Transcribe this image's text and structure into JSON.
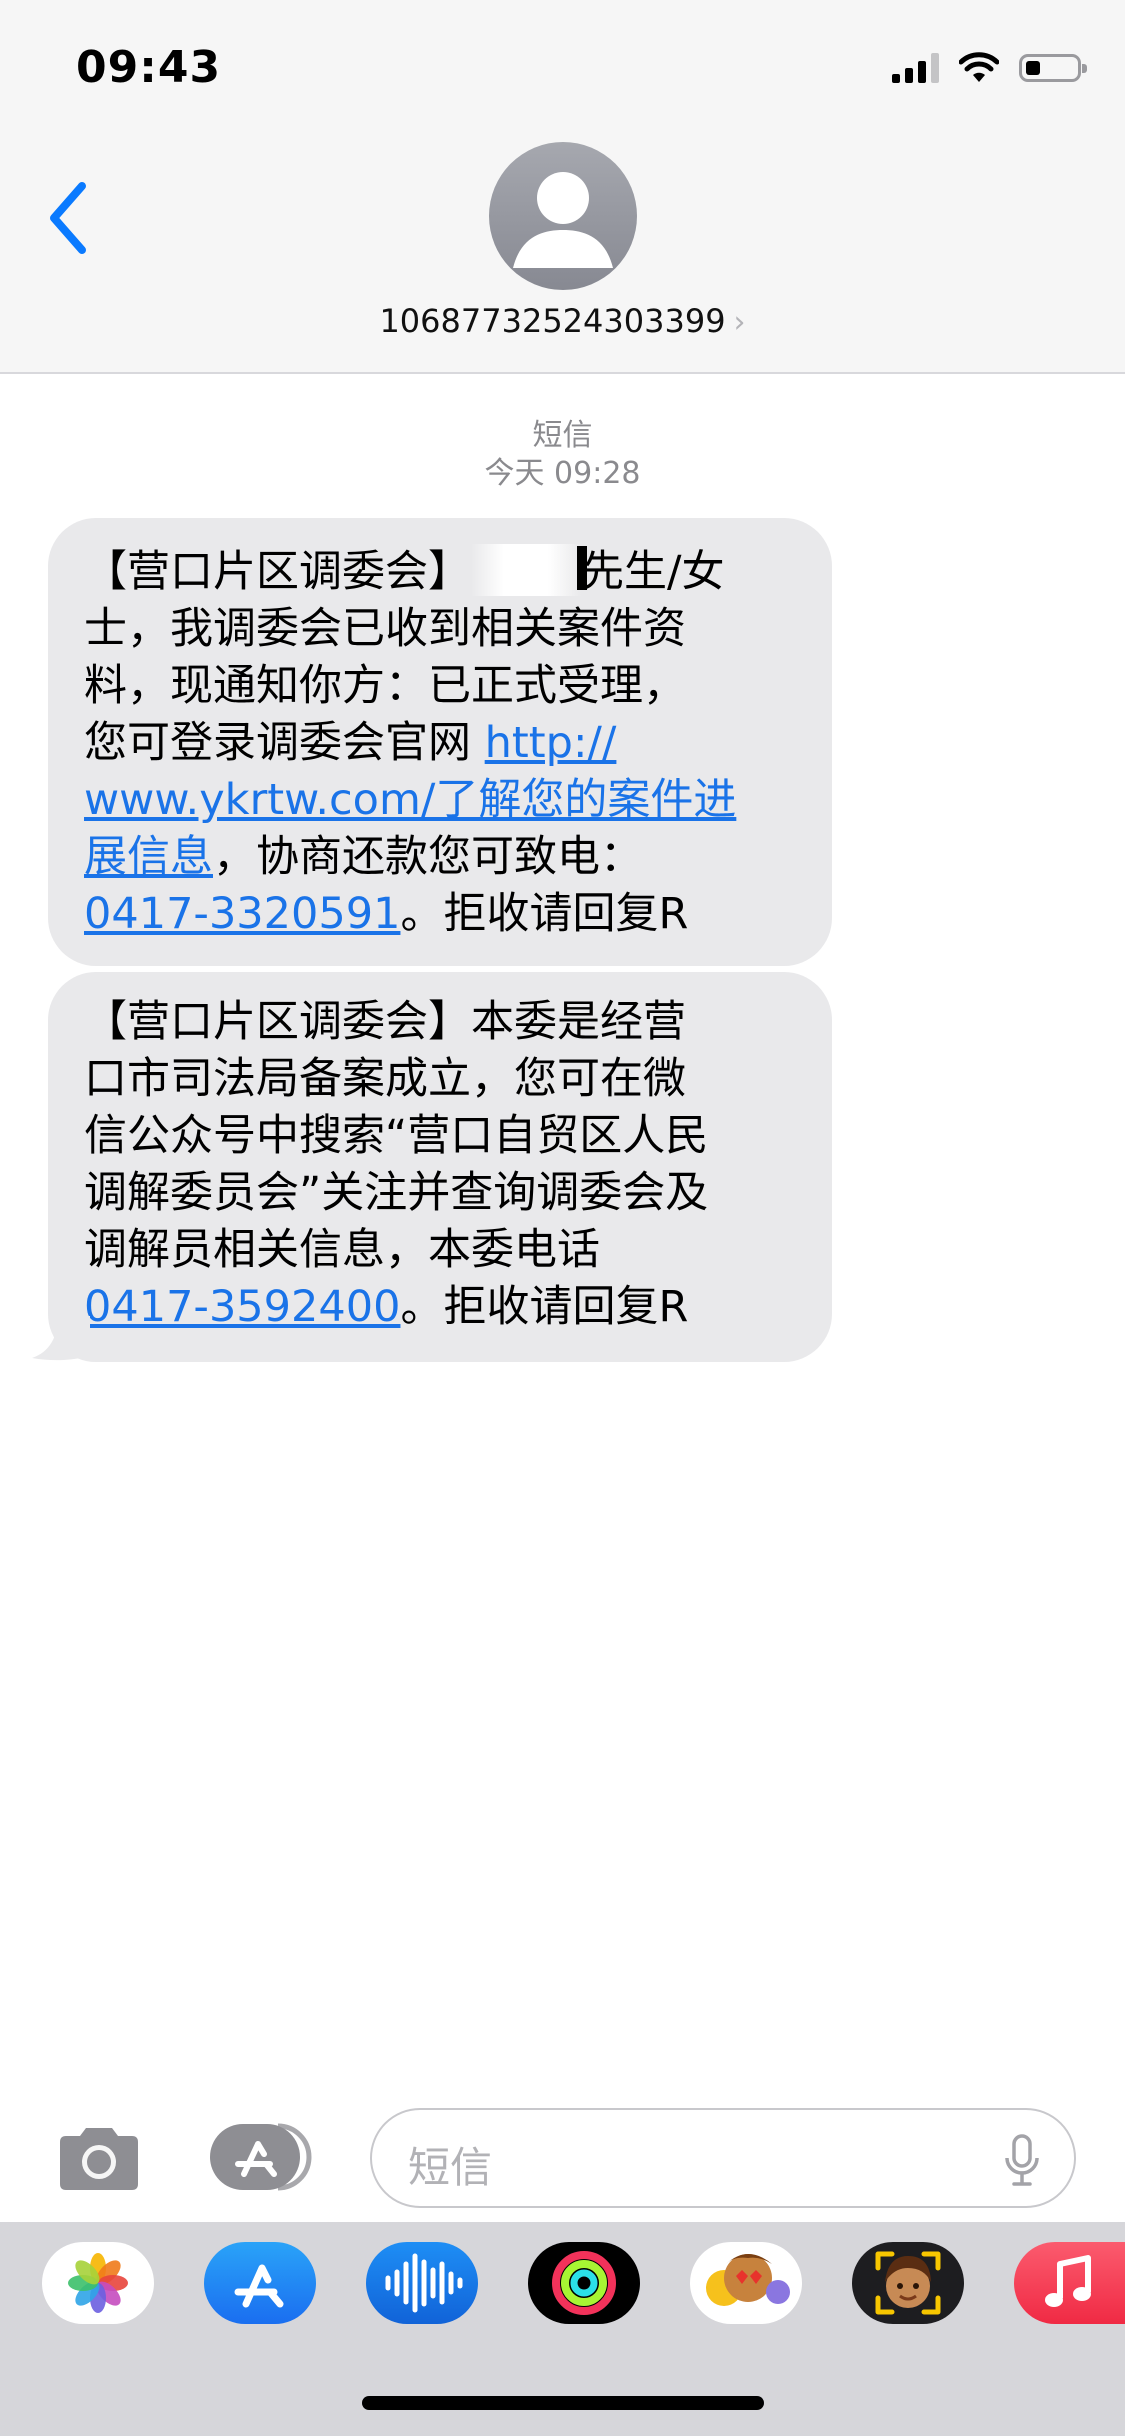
{
  "status_bar": {
    "time": "09:43"
  },
  "header": {
    "sender": "10687732524303399",
    "chevron": "›"
  },
  "thread": {
    "service_label": "短信",
    "timestamp": "今天 09:28"
  },
  "messages": [
    {
      "line1_start": "【营口片区调委会】",
      "line1_end": "先生/女",
      "line2": "士，我调委会已收到相关案件资",
      "line3": "料，现通知你方：已正式受理，",
      "line4_text": "您可登录调委会官网 ",
      "link_part1": "http://",
      "link_part2": "www.ykrtw.com/了解您的案件进",
      "link_part3": "展信息",
      "line6_text": "，协商还款您可致电：",
      "phone": "0417-3320591",
      "phone_suffix": "。拒收请回复R"
    },
    {
      "line1": "【营口片区调委会】本委是经营",
      "line2": "口市司法局备案成立，您可在微",
      "line3": "信公众号中搜索“营口自贸区人民",
      "line4": "调解委员会”关注并查询调委会及",
      "line5": "调解员相关信息，本委电话",
      "phone": "0417-3592400",
      "phone_suffix": "。拒收请回复R"
    }
  ],
  "input": {
    "placeholder": "短信"
  },
  "dock_apps": [
    "photos-icon",
    "app-store-icon",
    "audio-waveform-icon",
    "activity-rings-icon",
    "animoji-stickers-icon",
    "memoji-icon",
    "music-icon"
  ],
  "colors": {
    "link": "#1a73e8",
    "accent": "#0a7aff",
    "bubble": "#e9e9eb"
  }
}
